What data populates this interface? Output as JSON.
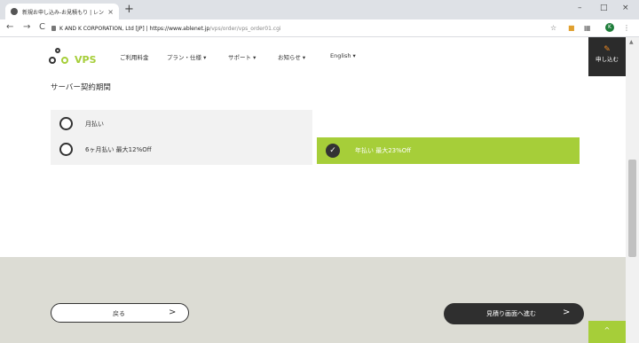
{
  "browser": {
    "tab_title": "新規お申し込み-お見積もり | レンタ...",
    "tab_close": "×",
    "new_tab": "+",
    "window_controls": [
      "–",
      "□",
      "×"
    ],
    "nav": {
      "back": "←",
      "forward": "→",
      "reload": "C"
    },
    "address_host": "K AND K CORPORATION, Ltd [JP] | https://www.ablenet.jp",
    "address_path": "/vps/order/vps_order01.cgi",
    "profile_initial": "K",
    "toolbar_icons": [
      "star-icon",
      "extension-icon",
      "extension-icon",
      "menu-icon"
    ]
  },
  "header": {
    "logo_text": "VPS",
    "nav_items": [
      {
        "label": "ご利用料金"
      },
      {
        "label": "プラン・仕様 ▾"
      },
      {
        "label": "サポート ▾"
      },
      {
        "label": "お知らせ ▾"
      },
      {
        "label": "English ▾"
      }
    ],
    "apply_label": "申し込む"
  },
  "section_title": "サーバー契約期間",
  "options": [
    {
      "label": "月払い",
      "selected": false
    },
    {
      "label": "6ヶ月払い 最大12%Off",
      "selected": false
    },
    {
      "label": "年払い 最大23%Off",
      "selected": true
    }
  ],
  "footer": {
    "back_label": "戻る",
    "back_arrow": ">",
    "quote_label": "見積り画面へ進む",
    "quote_arrow": ">",
    "to_top": "^"
  },
  "colors": {
    "accent": "#a6ce39",
    "dark": "#2f2f2f",
    "band": "#dcdcd4"
  }
}
